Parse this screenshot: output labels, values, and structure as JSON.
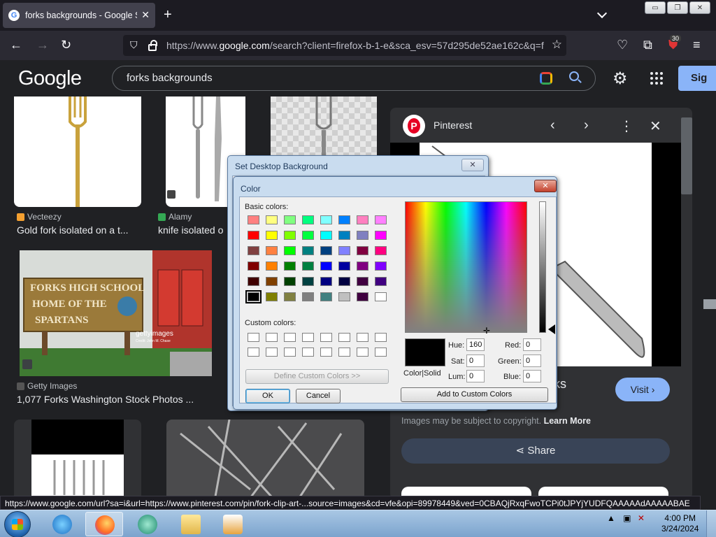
{
  "browser": {
    "tab_title": "forks backgrounds - Google Search",
    "tab_close": "✕",
    "new_tab": "+",
    "url_prefix": "https://www.",
    "url_domain": "google.com",
    "url_rest": "/search?client=firefox-b-1-e&sca_esv=57d295de52ae162c&q=f",
    "extensions_badge": "30",
    "window_buttons": [
      "▭",
      "❐",
      "✕"
    ]
  },
  "google": {
    "logo": "Google",
    "search_query": "forks backgrounds",
    "sign_in": "Sig"
  },
  "results": [
    {
      "source": "Vecteezy",
      "title": "Gold fork isolated on a t...",
      "source_color": "#f4a030"
    },
    {
      "source": "Alamy",
      "title": "knife isolated o",
      "source_color": "#34a853"
    },
    {
      "source": "Getty Images",
      "title": "1,077 Forks Washington Stock Photos ...",
      "source_color": "#555555"
    }
  ],
  "school_sign": {
    "line1": "FORKS HIGH SCHOOL",
    "line2": "HOME OF THE",
    "line3": "SPARTANS",
    "watermark": "gettyimages",
    "credit": "Credit: John M. Chase"
  },
  "panel": {
    "site": "Pinterest",
    "heading": "orks",
    "visit": "Visit",
    "copyright": "Images may be subject to copyright.",
    "learn_more": "Learn More",
    "share": "Share"
  },
  "status_url": "https://www.google.com/url?sa=i&url=https://www.pinterest.com/pin/fork-clip-art-...source=images&cd=vfe&opi=89978449&ved=0CBAQjRxqFwoTCPi0tJPYjYUDFQAAAAAdAAAAABAE",
  "setbg_dialog": {
    "title": "Set Desktop Background",
    "close": "✕"
  },
  "color_dialog": {
    "title": "Color",
    "close": "✕",
    "basic_colors_label": "Basic colors:",
    "custom_colors_label": "Custom colors:",
    "define_custom": "Define Custom Colors >>",
    "ok": "OK",
    "cancel": "Cancel",
    "color_solid": "Color|Solid",
    "add_custom": "Add to Custom Colors",
    "hue_label": "Hue:",
    "hue": "160",
    "sat_label": "Sat:",
    "sat": "0",
    "lum_label": "Lum:",
    "lum": "0",
    "red_label": "Red:",
    "red": "0",
    "green_label": "Green:",
    "green": "0",
    "blue_label": "Blue:",
    "blue": "0",
    "basic_colors": [
      "#ff8080",
      "#ffff80",
      "#80ff80",
      "#00ff80",
      "#80ffff",
      "#0080ff",
      "#ff80c0",
      "#ff80ff",
      "#ff0000",
      "#ffff00",
      "#80ff00",
      "#00ff40",
      "#00ffff",
      "#0080c0",
      "#8080c0",
      "#ff00ff",
      "#804040",
      "#ff8040",
      "#00ff00",
      "#008080",
      "#004080",
      "#8080ff",
      "#800040",
      "#ff0080",
      "#800000",
      "#ff8000",
      "#008000",
      "#008040",
      "#0000ff",
      "#0000a0",
      "#800080",
      "#8000ff",
      "#400000",
      "#804000",
      "#004000",
      "#004040",
      "#000080",
      "#000040",
      "#400040",
      "#400080",
      "#000000",
      "#808000",
      "#808040",
      "#808080",
      "#408080",
      "#c0c0c0",
      "#400040",
      "#ffffff"
    ],
    "selected_index": 40
  },
  "taskbar": {
    "time": "4:00 PM",
    "date": "3/24/2024"
  }
}
